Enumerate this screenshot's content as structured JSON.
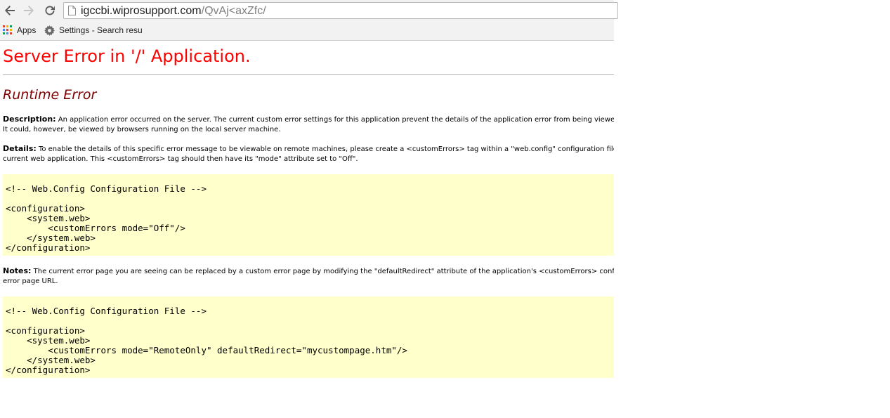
{
  "browser": {
    "url_host": "igccbi.wiprosupport.com",
    "url_path": "/QvAj<axZfc/",
    "bookmarks": [
      {
        "label": "Apps",
        "icon": "apps-grid-icon"
      },
      {
        "label": "Settings - Search resu",
        "icon": "gear-icon"
      }
    ]
  },
  "page": {
    "title": "Server Error in '/' Application.",
    "subtitle": "Runtime Error",
    "description_label": "Description:",
    "description_line1": "An application error occurred on the server. The current custom error settings for this application prevent the details of the application error from being viewed remo",
    "description_line2": "It could, however, be viewed by browsers running on the local server machine.",
    "details_label": "Details:",
    "details_line1": "To enable the details of this specific error message to be viewable on remote machines, please create a <customErrors> tag within a \"web.config\" configuration file locate",
    "details_line2": "current web application. This <customErrors> tag should then have its \"mode\" attribute set to \"Off\".",
    "code_block_1": "\n<!-- Web.Config Configuration File -->\n\n<configuration>\n    <system.web>\n        <customErrors mode=\"Off\"/>\n    </system.web>\n</configuration>",
    "notes_label": "Notes:",
    "notes_line1": "The current error page you are seeing can be replaced by a custom error page by modifying the \"defaultRedirect\" attribute of the application's <customErrors> configuratio",
    "notes_line2": "error page URL.",
    "code_block_2": "\n<!-- Web.Config Configuration File -->\n\n<configuration>\n    <system.web>\n        <customErrors mode=\"RemoteOnly\" defaultRedirect=\"mycustompage.htm\"/>\n    </system.web>\n</configuration>"
  }
}
